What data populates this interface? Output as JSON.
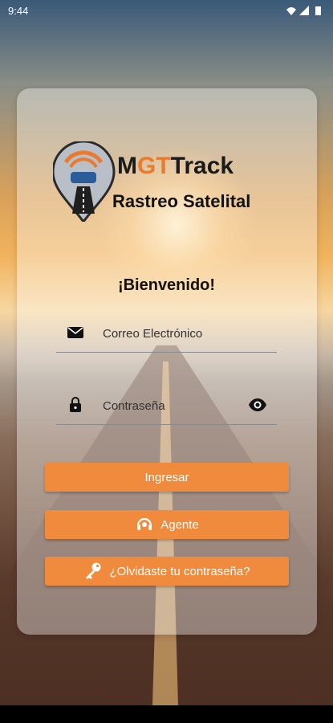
{
  "status_bar": {
    "time": "9:44"
  },
  "logo": {
    "brand_prefix": "M",
    "brand_g": "GT",
    "brand_suffix": "Track",
    "tagline": "Rastreo Satelital"
  },
  "welcome": "¡Bienvenido!",
  "email_field": {
    "placeholder": "Correo Electrónico",
    "icon": "mail-icon"
  },
  "password_field": {
    "placeholder": "Contraseña",
    "icon": "lock-icon",
    "toggle_icon": "eye-icon"
  },
  "buttons": {
    "login": "Ingresar",
    "agent": "Agente",
    "forgot": "¿Olvidaste tu contraseña?"
  },
  "colors": {
    "accent": "#f08a3c",
    "brand_orange": "#e97a2e",
    "logo_blue": "#2d5c9a"
  }
}
